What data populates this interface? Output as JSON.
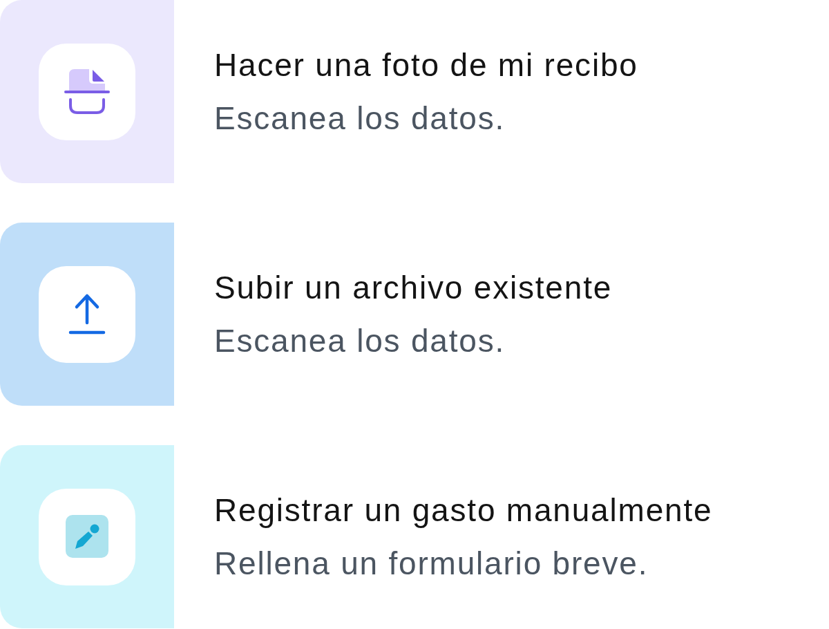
{
  "options": [
    {
      "kind": "photo",
      "color": "#ebe8fd",
      "title": "Hacer una foto de mi recibo",
      "description": "Escanea los datos."
    },
    {
      "kind": "upload",
      "color": "#bfdef9",
      "title": "Subir un archivo existente",
      "description": "Escanea los datos."
    },
    {
      "kind": "manual",
      "color": "#cff5fb",
      "title": "Registrar un gasto manualmente",
      "description": "Rellena un formulario breve."
    }
  ]
}
